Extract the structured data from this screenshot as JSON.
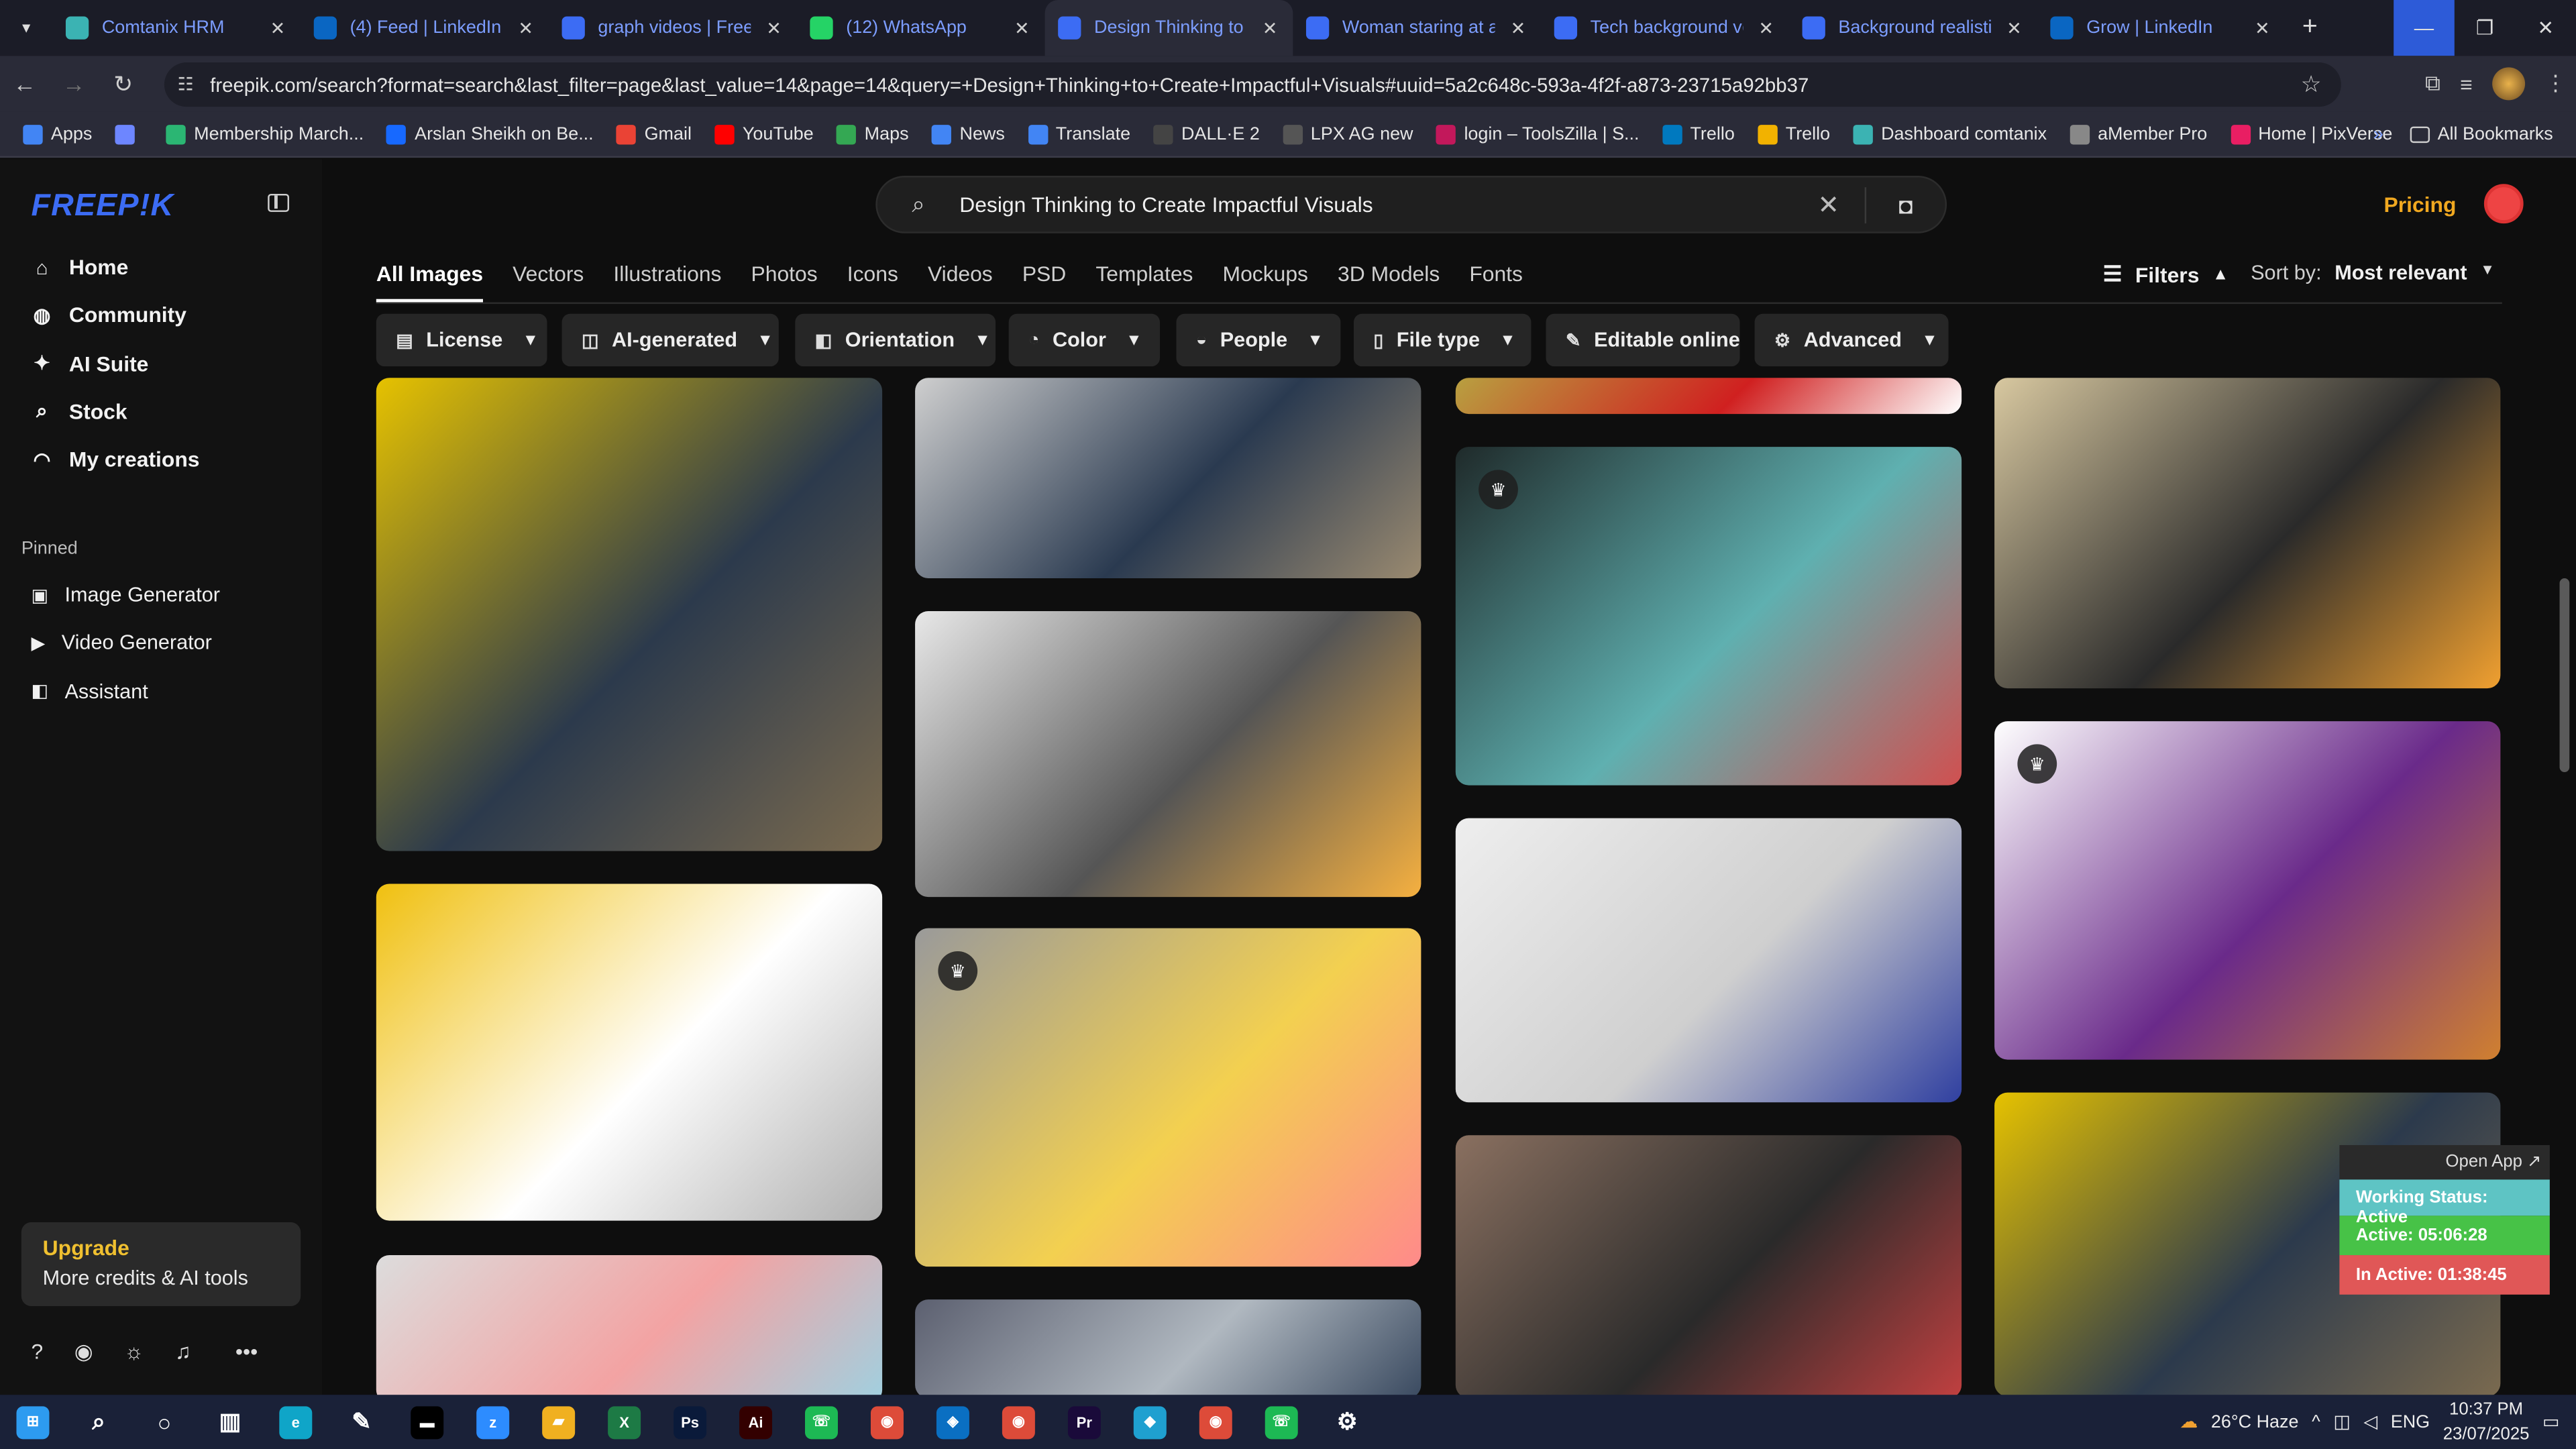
{
  "browser": {
    "tabs": [
      {
        "title": "Comtanix HRM",
        "favicon": "hrm-icon",
        "color": "#3bb3b3"
      },
      {
        "title": "(4) Feed | LinkedIn",
        "favicon": "linkedin-icon",
        "color": "#0a66c2"
      },
      {
        "title": "graph videos | Freepik",
        "favicon": "freepik-icon",
        "color": "#3c6cf4"
      },
      {
        "title": "(12) WhatsApp",
        "favicon": "whatsapp-icon",
        "color": "#25d366"
      },
      {
        "title": "Design Thinking to C",
        "favicon": "freepik-icon",
        "color": "#3c6cf4"
      },
      {
        "title": "Woman staring at a",
        "favicon": "freepik-icon",
        "color": "#3c6cf4"
      },
      {
        "title": "Tech background ve",
        "favicon": "freepik-icon",
        "color": "#3c6cf4"
      },
      {
        "title": "Background realistic",
        "favicon": "freepik-icon",
        "color": "#3c6cf4"
      },
      {
        "title": "Grow | LinkedIn",
        "favicon": "linkedin-icon",
        "color": "#0a66c2"
      }
    ],
    "url": "freepik.com/search?format=search&last_filter=page&last_value=14&page=14&query=+Design+Thinking+to+Create+Impactful+Visuals#uuid=5a2c648c-593a-4f2f-a873-23715a92bb37",
    "bookmarks": [
      {
        "label": "Apps",
        "color": "#4285f4"
      },
      {
        "label": "",
        "color": "#6d86ff"
      },
      {
        "label": "Membership March...",
        "color": "#2bb673"
      },
      {
        "label": "Arslan Sheikh on Be...",
        "color": "#1769ff"
      },
      {
        "label": "Gmail",
        "color": "#ea4335"
      },
      {
        "label": "YouTube",
        "color": "#ff0000"
      },
      {
        "label": "Maps",
        "color": "#34a853"
      },
      {
        "label": "News",
        "color": "#4285f4"
      },
      {
        "label": "Translate",
        "color": "#4285f4"
      },
      {
        "label": "DALL·E 2",
        "color": "#444444"
      },
      {
        "label": "LPX AG new",
        "color": "#555555"
      },
      {
        "label": "login – ToolsZilla | S...",
        "color": "#c2185b"
      },
      {
        "label": "Trello",
        "color": "#0079bf"
      },
      {
        "label": "Trello",
        "color": "#f2b200"
      },
      {
        "label": "Dashboard comtanix",
        "color": "#3bb3b3"
      },
      {
        "label": "aMember Pro",
        "color": "#888888"
      },
      {
        "label": "Home | PixVerse",
        "color": "#e91e63"
      }
    ],
    "all_bookmarks": "All Bookmarks"
  },
  "sidebar": {
    "logo": "FREEP!K",
    "nav": [
      {
        "label": "Home",
        "icon": "home-icon"
      },
      {
        "label": "Community",
        "icon": "globe-icon"
      },
      {
        "label": "AI Suite",
        "icon": "sparkle-icon"
      },
      {
        "label": "Stock",
        "icon": "search-icon"
      },
      {
        "label": "My creations",
        "icon": "user-icon"
      }
    ],
    "pinned_header": "Pinned",
    "pinned": [
      {
        "label": "Image Generator",
        "icon": "image-icon"
      },
      {
        "label": "Video Generator",
        "icon": "video-icon"
      },
      {
        "label": "Assistant",
        "icon": "assistant-icon"
      }
    ],
    "upgrade": {
      "title": "Upgrade",
      "subtitle": "More credits & AI tools"
    }
  },
  "search": {
    "query": "Design Thinking to Create Impactful Visuals"
  },
  "header": {
    "pricing": "Pricing"
  },
  "type_tabs": [
    "All Images",
    "Vectors",
    "Illustrations",
    "Photos",
    "Icons",
    "Videos",
    "PSD",
    "Templates",
    "Mockups",
    "3D Models",
    "Fonts"
  ],
  "filters_label": "Filters",
  "sort": {
    "label": "Sort by:",
    "value": "Most relevant"
  },
  "chips": [
    {
      "label": "License",
      "icon": "license-icon"
    },
    {
      "label": "AI-generated",
      "icon": "ai-icon"
    },
    {
      "label": "Orientation",
      "icon": "orientation-icon"
    },
    {
      "label": "Color",
      "icon": "color-icon"
    },
    {
      "label": "People",
      "icon": "people-icon"
    },
    {
      "label": "File type",
      "icon": "file-icon"
    },
    {
      "label": "Editable online",
      "icon": "edit-icon"
    },
    {
      "label": "Advanced",
      "icon": "gear-icon"
    }
  ],
  "cards": [
    {
      "premium": false,
      "colors": [
        "#e6c200",
        "#2c3a4c",
        "#7a6a4f"
      ]
    },
    {
      "premium": false,
      "colors": [
        "#f0c010",
        "#ffffff",
        "#b0b0b0"
      ]
    },
    {
      "premium": false,
      "colors": [
        "#dcdcdc",
        "#f3a3a3",
        "#a0d0e0"
      ]
    },
    {
      "premium": false,
      "colors": [
        "#cfcfcf",
        "#2a3a50",
        "#9a8a70"
      ]
    },
    {
      "premium": false,
      "colors": [
        "#e8e8e8",
        "#555555",
        "#f5b040"
      ]
    },
    {
      "premium": true,
      "colors": [
        "#9a9a9a",
        "#f3d050",
        "#ff8a8a"
      ]
    },
    {
      "premium": false,
      "colors": [
        "#5c6070",
        "#b0b8c0",
        "#3a4a60"
      ]
    },
    {
      "premium": false,
      "colors": [
        "#b8a040",
        "#d02020",
        "#ffffff"
      ]
    },
    {
      "premium": true,
      "colors": [
        "#1f2a2a",
        "#5fb0b0",
        "#d05050"
      ]
    },
    {
      "premium": false,
      "colors": [
        "#eeeeee",
        "#cfcfcf",
        "#3040a0"
      ]
    },
    {
      "premium": false,
      "colors": [
        "#8a7060",
        "#2a2a2a",
        "#c04040"
      ]
    },
    {
      "premium": false,
      "colors": [
        "#d8c8a0",
        "#2a2a2a",
        "#f0a030"
      ]
    },
    {
      "premium": true,
      "colors": [
        "#ffffff",
        "#6a2a8a",
        "#d08030"
      ]
    }
  ],
  "widget": {
    "open": "Open App ↗",
    "status": "Working Status: Active",
    "active": "Active: 05:06:28",
    "inactive": "In Active: 01:38:45"
  },
  "taskbar": {
    "weather": "26°C Haze",
    "lang": "ENG",
    "time": "10:37 PM",
    "date": "23/07/2025"
  }
}
